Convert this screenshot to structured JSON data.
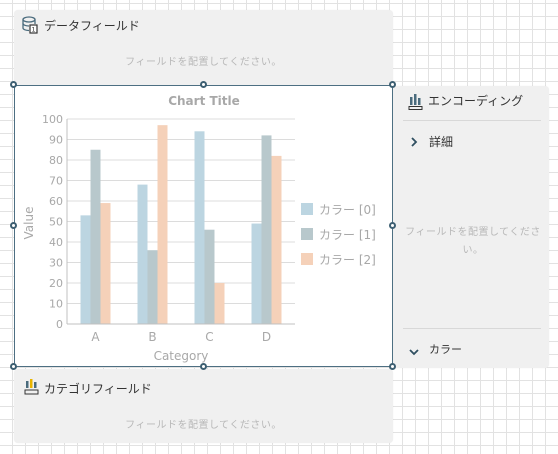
{
  "data_field_panel": {
    "title": "データフィールド",
    "placeholder": "フィールドを配置してください。",
    "icon": "database-field-icon"
  },
  "category_field_panel": {
    "title": "カテゴリフィールド",
    "placeholder": "フィールドを配置してください。",
    "icon": "category-field-icon"
  },
  "encoding_panel": {
    "title": "エンコーディング",
    "detail_label": "詳細",
    "placeholder": "フィールドを配置してください。",
    "color_label": "カラー",
    "icon": "encoding-chart-icon"
  },
  "chart_data": {
    "type": "bar",
    "title": "Chart Title",
    "xlabel": "Category",
    "ylabel": "Value",
    "categories": [
      "A",
      "B",
      "C",
      "D"
    ],
    "ylim": [
      0,
      100
    ],
    "yticks": [
      0,
      10,
      20,
      30,
      40,
      50,
      60,
      70,
      80,
      90,
      100
    ],
    "grid": true,
    "legend_position": "right",
    "series": [
      {
        "name": "カラー [0]",
        "values": [
          53,
          68,
          94,
          49
        ],
        "color": "#bcd5e1"
      },
      {
        "name": "カラー [1]",
        "values": [
          85,
          36,
          46,
          92
        ],
        "color": "#b8c8cc"
      },
      {
        "name": "カラー [2]",
        "values": [
          59,
          97,
          20,
          82
        ],
        "color": "#f5d1b9"
      }
    ]
  },
  "colors": {
    "panel_bg": "#f0f0f0",
    "selection_border": "#3d5f72",
    "axis_text": "#a8a8a8"
  }
}
